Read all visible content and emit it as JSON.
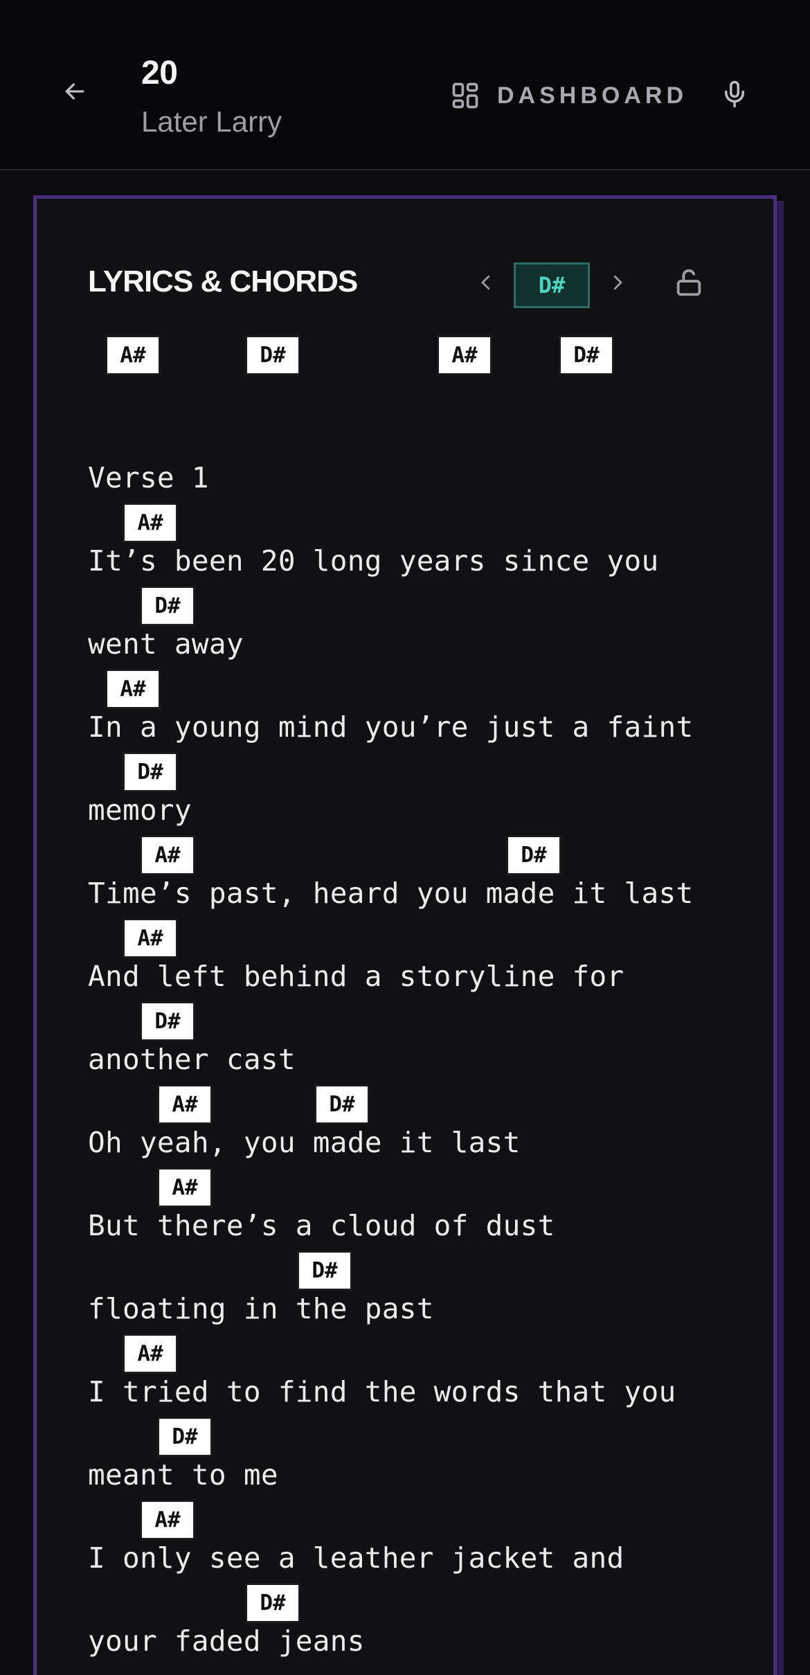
{
  "header": {
    "title": "20",
    "artist": "Later Larry",
    "dashboard_label": "DASHBOARD"
  },
  "card": {
    "section_title": "LYRICS & CHORDS",
    "current_key": "D#"
  },
  "intro_chords": [
    "A#",
    "D#",
    "A#",
    "D#"
  ],
  "lines": [
    {
      "text": "Verse 1"
    },
    {
      "text": "It’s been 20 long years since you",
      "chords": [
        "A#"
      ]
    },
    {
      "text": "went away",
      "chords": [
        "D#"
      ]
    },
    {
      "text": "In a young mind you’re just a faint",
      "chords": [
        "A#"
      ]
    },
    {
      "text": "memory",
      "chords": [
        "D#"
      ]
    },
    {
      "text": "Time’s past, heard you made it last",
      "chords": [
        "A#",
        "D#"
      ]
    },
    {
      "text": "And left behind a storyline for",
      "chords": [
        "A#"
      ]
    },
    {
      "text": "another cast",
      "chords": [
        "D#"
      ]
    },
    {
      "text": "Oh yeah, you made it last",
      "chords": [
        "A#",
        "D#"
      ]
    },
    {
      "text": "But there’s a cloud of dust",
      "chords": [
        "A#"
      ]
    },
    {
      "text": "floating in the past",
      "chords": [
        "D#"
      ]
    },
    {
      "text": "I tried to find the words that you",
      "chords": [
        "A#"
      ]
    },
    {
      "text": "meant to me",
      "chords": [
        "D#"
      ]
    },
    {
      "text": "I only see a leather jacket and",
      "chords": [
        "A#"
      ]
    },
    {
      "text": "your faded jeans",
      "chords": [
        "D#"
      ]
    }
  ]
}
